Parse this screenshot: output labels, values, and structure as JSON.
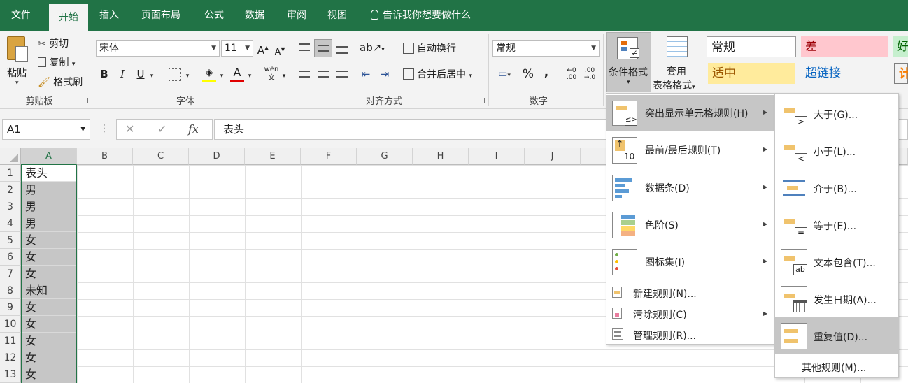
{
  "tabs": [
    "文件",
    "开始",
    "插入",
    "页面布局",
    "公式",
    "数据",
    "审阅",
    "视图"
  ],
  "tellme": "告诉我你想要做什么",
  "clipboard": {
    "paste": "粘贴",
    "cut": "剪切",
    "copy": "复制",
    "format_painter": "格式刷",
    "label": "剪贴板"
  },
  "font": {
    "name": "宋体",
    "size": "11",
    "bold": "B",
    "italic": "I",
    "underline": "U",
    "label": "字体",
    "grow": "A",
    "shrink": "A",
    "color_letter": "A",
    "phonetic": "wén"
  },
  "alignment": {
    "wrap": "自动换行",
    "merge": "合并后居中",
    "label": "对齐方式"
  },
  "number": {
    "format": "常规",
    "percent": "%",
    "comma": ",",
    "label": "数字"
  },
  "styles": {
    "cond_format_line1": "条件格式",
    "table_format_line1": "套用",
    "table_format_line2": "表格格式",
    "normal": "常规",
    "bad": "差",
    "good": "好",
    "neutral": "适中",
    "hyperlink": "超链接",
    "calc": "计"
  },
  "colors": {
    "excel_green": "#217346",
    "bad_bg": "#ffc7ce",
    "bad_fg": "#9c0006",
    "good_bg": "#c6efce",
    "good_fg": "#006100",
    "neutral_bg": "#ffeb9c",
    "neutral_fg": "#9c5700",
    "hyperlink": "#0563c1",
    "selection": "#c6c6c6"
  },
  "formula_bar": {
    "name_box": "A1",
    "cancel": "✕",
    "enter": "✓",
    "fx": "fx",
    "content": "表头"
  },
  "columns": [
    "A",
    "B",
    "C",
    "D",
    "E",
    "F",
    "G",
    "H",
    "I",
    "J"
  ],
  "rows": [
    "1",
    "2",
    "3",
    "4",
    "5",
    "6",
    "7",
    "8",
    "9",
    "10",
    "11",
    "12",
    "13"
  ],
  "cells_A": [
    "表头",
    "男",
    "男",
    "男",
    "女",
    "女",
    "女",
    "未知",
    "女",
    "女",
    "女",
    "女",
    "女"
  ],
  "cond_menu": {
    "items": [
      {
        "label": "突出显示单元格规则(H)",
        "icon": "highlight-rules-icon"
      },
      {
        "label": "最前/最后规则(T)",
        "icon": "top-bottom-rules-icon"
      },
      {
        "label": "数据条(D)",
        "icon": "data-bars-icon"
      },
      {
        "label": "色阶(S)",
        "icon": "color-scales-icon"
      },
      {
        "label": "图标集(I)",
        "icon": "icon-sets-icon"
      }
    ],
    "small_items": [
      {
        "label": "新建规则(N)...",
        "icon": "new-rule-icon"
      },
      {
        "label": "清除规则(C)",
        "icon": "clear-rules-icon"
      },
      {
        "label": "管理规则(R)...",
        "icon": "manage-rules-icon"
      }
    ],
    "icon_number": "10"
  },
  "sub_menu": {
    "items": [
      {
        "label": "大于(G)...",
        "symbol": ">"
      },
      {
        "label": "小于(L)...",
        "symbol": "<"
      },
      {
        "label": "介于(B)...",
        "symbol": ""
      },
      {
        "label": "等于(E)...",
        "symbol": "="
      },
      {
        "label": "文本包含(T)...",
        "symbol": "ab"
      },
      {
        "label": "发生日期(A)...",
        "symbol": ""
      },
      {
        "label": "重复值(D)...",
        "symbol": ""
      }
    ],
    "more": "其他规则(M)..."
  }
}
